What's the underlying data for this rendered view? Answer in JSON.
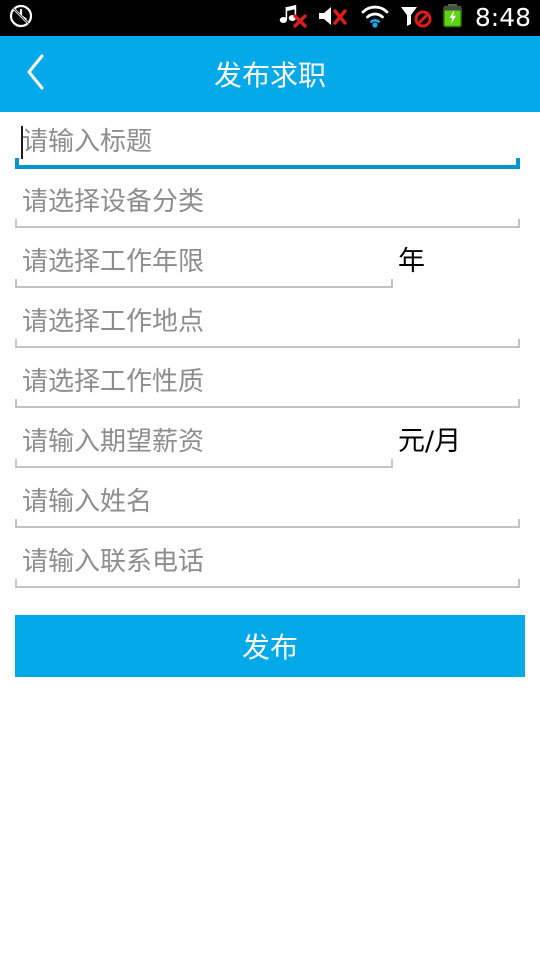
{
  "status_bar": {
    "icons": [
      {
        "name": "alarm-off-icon",
        "label": "alarm disabled"
      },
      {
        "name": "music-off-icon",
        "label": "music off"
      },
      {
        "name": "volume-mute-icon",
        "label": "volume muted"
      },
      {
        "name": "wifi-icon",
        "label": "wifi connected"
      },
      {
        "name": "no-signal-icon",
        "label": "no cellular signal"
      },
      {
        "name": "battery-charging-icon",
        "label": "battery charging"
      }
    ],
    "time": "8:48"
  },
  "header": {
    "title": "发布求职",
    "back_label": "返回"
  },
  "form": {
    "fields": [
      {
        "name": "title",
        "placeholder": "请输入标题",
        "suffix": "",
        "focused": true,
        "width": "wide",
        "control": "text-input"
      },
      {
        "name": "equipment-category",
        "placeholder": "请选择设备分类",
        "suffix": "",
        "focused": false,
        "width": "wide",
        "control": "select"
      },
      {
        "name": "work-years",
        "placeholder": "请选择工作年限",
        "suffix": "年",
        "focused": false,
        "width": "narrow",
        "control": "select"
      },
      {
        "name": "work-location",
        "placeholder": "请选择工作地点",
        "suffix": "",
        "focused": false,
        "width": "wide",
        "control": "select"
      },
      {
        "name": "work-type",
        "placeholder": "请选择工作性质",
        "suffix": "",
        "focused": false,
        "width": "wide",
        "control": "select"
      },
      {
        "name": "expected-salary",
        "placeholder": "请输入期望薪资",
        "suffix": "元/月",
        "focused": false,
        "width": "narrow",
        "control": "text-input"
      },
      {
        "name": "full-name",
        "placeholder": "请输入姓名",
        "suffix": "",
        "focused": false,
        "width": "wide",
        "control": "text-input"
      },
      {
        "name": "contact-phone",
        "placeholder": "请输入联系电话",
        "suffix": "",
        "focused": false,
        "width": "wide",
        "control": "text-input"
      }
    ],
    "submit_label": "发布"
  },
  "colors": {
    "accent": "#03a9e9",
    "focus_underline": "#0296d1",
    "underline": "#c3c3c3",
    "placeholder": "#8d8d8d",
    "suffix_text": "#000000",
    "statusbar_bg": "#000000",
    "page_bg": "#ffffff"
  }
}
